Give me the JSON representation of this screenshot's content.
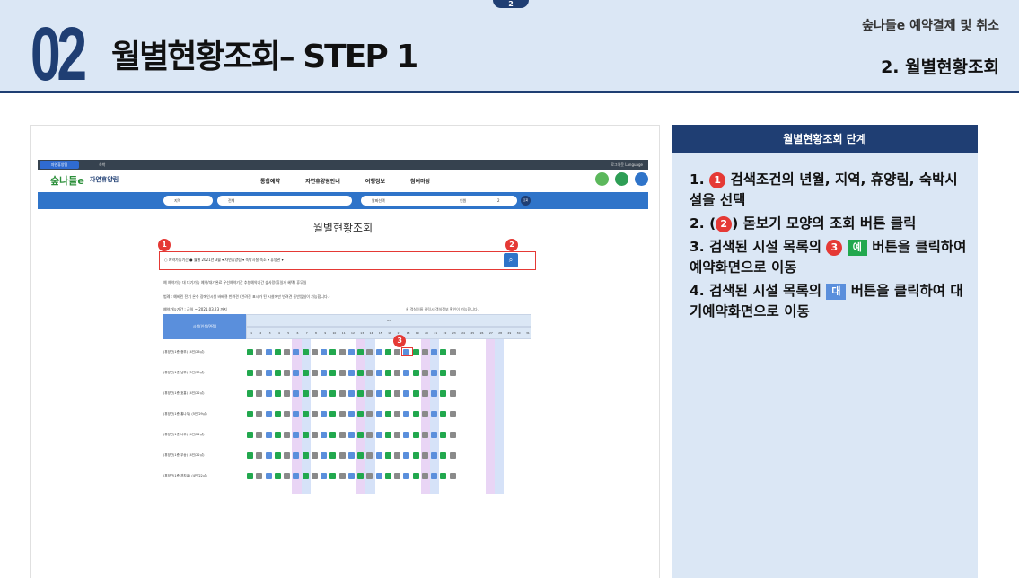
{
  "header": {
    "page_tab": "2",
    "section_number": "02",
    "title": "월별현황조회– STEP 1",
    "category": "숲나들e 예약결제 및 취소",
    "subtitle": "2. 월별현황조회"
  },
  "screenshot": {
    "topbar": {
      "site_tab": "자연휴양림",
      "menu": "숙박",
      "right": "로그아웃  Language"
    },
    "logo": "숲나들e",
    "logo_sub": "자연휴양림",
    "nav_menu": [
      "통합예약",
      "자연휴양림안내",
      "여행정보",
      "참여마당"
    ],
    "search": {
      "region": "지역",
      "forest": "전체",
      "date": "날짜선택",
      "people": "인원",
      "count": "2",
      "go": "조회"
    },
    "page_title": "월별현황조회",
    "filter_text": "○ 예약가능기간  ● 월별   2021년 3월 ▾   자연휴양림   ▾   숙박시설  숙소   ▾  휴양관 ▾",
    "legend_row1": "예 예약가능   대 대기가능   예약/대기완료   우선예약기간   추첨예약기간   숲사랑(휴일가 혜택)   휴무일",
    "legend_row2": "범례 :  예비린  전기  온수  장애인시설  바베큐  반려견   (반려견 표시가 된 시설에만 반려견 동반입실이 가능합니다.)",
    "period": "예약가능기간 : 금일 ~ 2021.03.23 까지",
    "period_note": "※ 객실이름 클릭시 객실정보 확인이 가능합니다.",
    "cal_header": "시설(인실/면적)",
    "cal_month": "03",
    "days": [
      "1",
      "2",
      "3",
      "4",
      "5",
      "6",
      "7",
      "8",
      "9",
      "10",
      "11",
      "12",
      "13",
      "14",
      "15",
      "16",
      "17",
      "18",
      "19",
      "20",
      "21",
      "22",
      "23",
      "24",
      "25",
      "26",
      "27",
      "28",
      "29",
      "30",
      "31"
    ],
    "rows": [
      "(휴양관)1층(중부) (4인/26㎡)",
      "(휴양관)1층(남부) (5인/30㎡)",
      "(휴양관)1층(호홍) (4인/22㎡)",
      "(휴양관)1층(홍나무) (5인/29㎡)",
      "(휴양관)1층(나무) (4인/22㎡)",
      "(휴양관)1층(우송) (4인/22㎡)",
      "(휴양관)1층(까치골) (4인/22㎡)"
    ],
    "badges": [
      "1",
      "2",
      "3"
    ]
  },
  "panel": {
    "title": "월별현황조회 단계",
    "steps": [
      {
        "num": "1.",
        "badge": "1",
        "text": "검색조건의 년월, 지역, 휴양림, 숙박시설을 선택"
      },
      {
        "num": "2.",
        "pre": "(",
        "badge": "2",
        "text": ") 돋보기 모양의 조회 버튼 클릭"
      },
      {
        "num": "3.",
        "pre": "검색된 시설 목록의",
        "badge": "3",
        "button": "예",
        "text": "버튼을 클릭하여 예약화면으로 이동"
      },
      {
        "num": "4.",
        "pre": "검색된 시설 목록의",
        "button": "대",
        "text": "버튼을 클릭하여 대기예약화면으로 이동"
      }
    ]
  },
  "colors": {
    "navy": "#1f3e73",
    "light_blue": "#dbe7f5",
    "badge_red": "#e53935",
    "available_green": "#22a84e",
    "wait_blue": "#5a8fdc"
  }
}
